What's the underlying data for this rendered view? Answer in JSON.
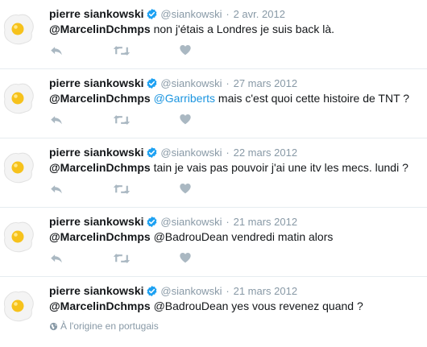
{
  "tweets": [
    {
      "author_name": "pierre siankowski",
      "handle": "@siankowski",
      "separator": "·",
      "date": "2 avr. 2012",
      "reply_to": "@MarcelinDchmps",
      "mention2": "",
      "body": " non j'étais a Londres je suis back là."
    },
    {
      "author_name": "pierre siankowski",
      "handle": "@siankowski",
      "separator": "·",
      "date": "27 mars 2012",
      "reply_to": "@MarcelinDchmps",
      "mention2": " @Garriberts",
      "body": " mais c'est quoi cette histoire de TNT ?"
    },
    {
      "author_name": "pierre siankowski",
      "handle": "@siankowski",
      "separator": "·",
      "date": "22 mars 2012",
      "reply_to": "@MarcelinDchmps",
      "mention2": "",
      "body": " tain je vais pas pouvoir j'ai une itv les mecs. lundi ?"
    },
    {
      "author_name": "pierre siankowski",
      "handle": "@siankowski",
      "separator": "·",
      "date": "21 mars 2012",
      "reply_to": "@MarcelinDchmps",
      "mention2": "",
      "body": " @BadrouDean vendredi matin alors"
    },
    {
      "author_name": "pierre siankowski",
      "handle": "@siankowski",
      "separator": "·",
      "date": "21 mars 2012",
      "reply_to": "@MarcelinDchmps",
      "mention2": "",
      "body": " @BadrouDean yes vous revenez quand ?"
    }
  ],
  "translate_note": "À l'origine en portugais",
  "icons": {
    "avatar": "fried-egg-avatar",
    "verified": "verified-badge-icon",
    "reply": "reply-icon",
    "retweet": "retweet-icon",
    "like": "heart-icon",
    "globe": "globe-icon"
  },
  "colors": {
    "verified": "#1da1f2",
    "link": "#1b95e0",
    "muted": "#8899a6",
    "action_icon": "#aab8c2",
    "divider": "#e6ecf0"
  }
}
